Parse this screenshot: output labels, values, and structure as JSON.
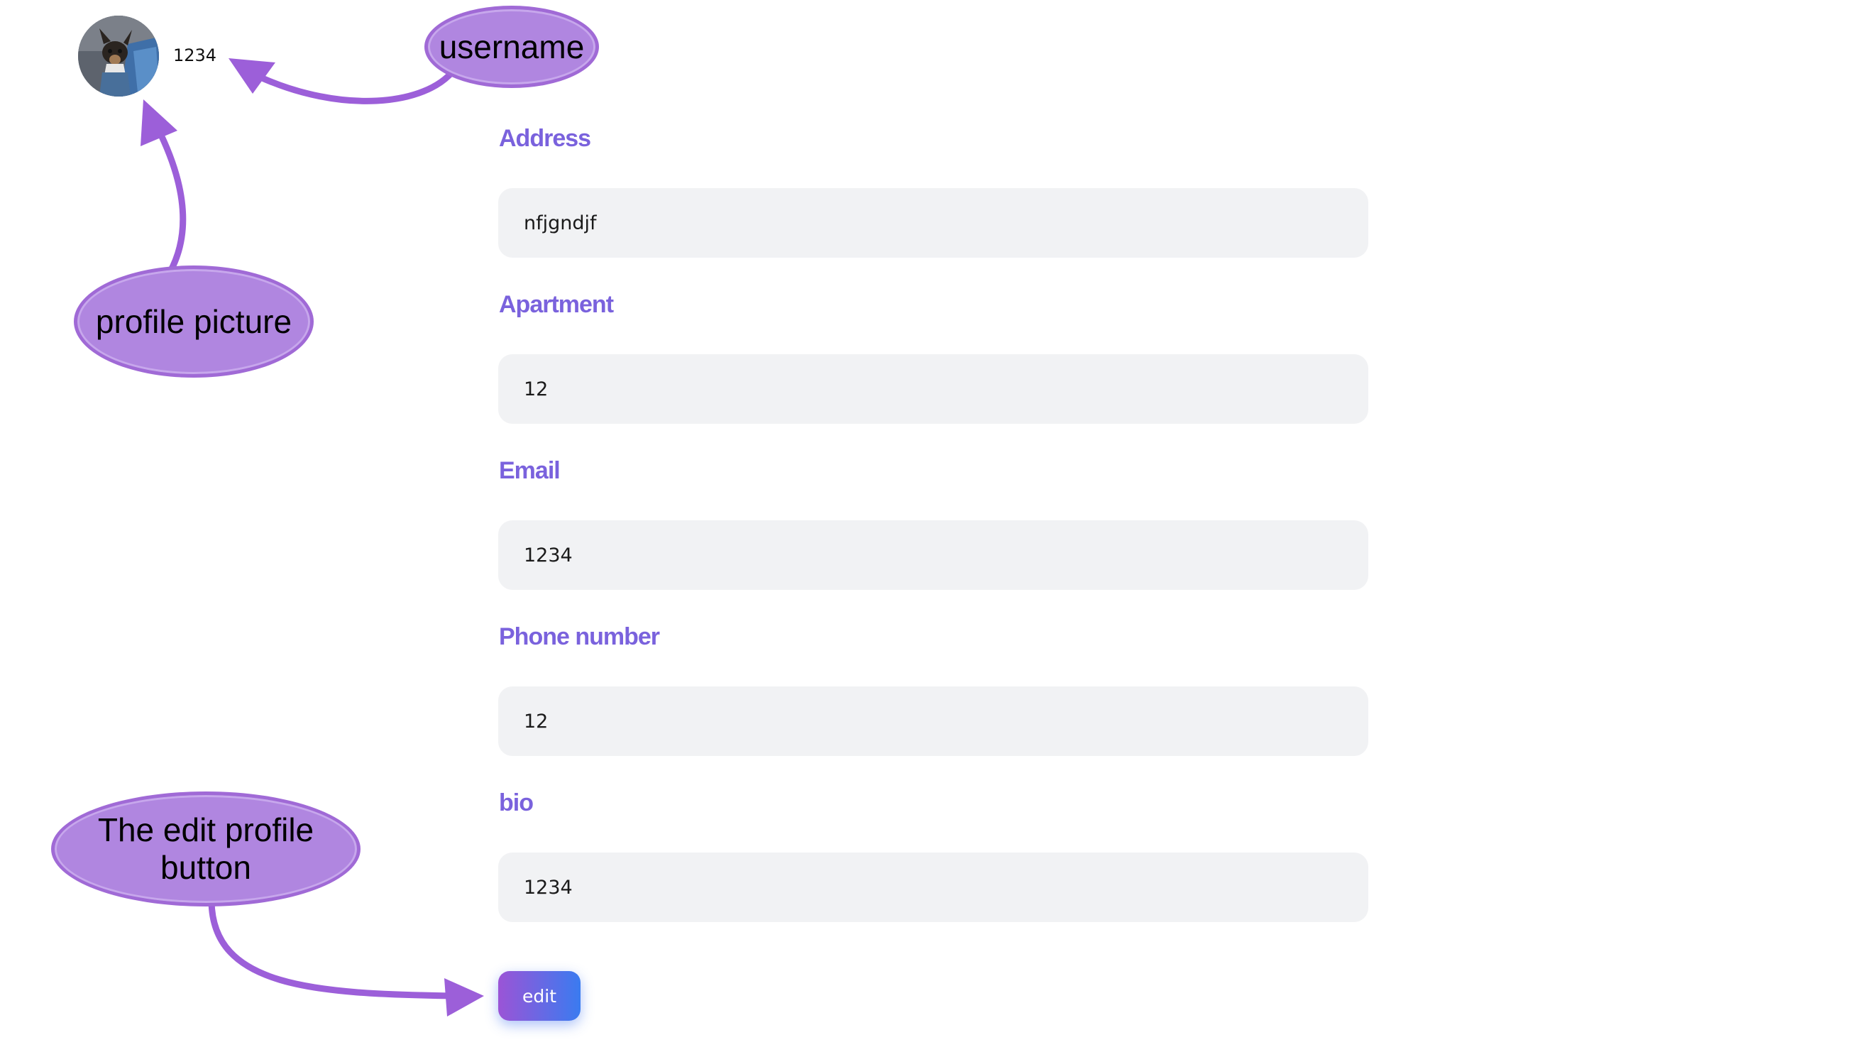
{
  "profile": {
    "username": "1234",
    "avatar_icon": "profile-photo"
  },
  "form": {
    "fields": [
      {
        "label": "Address",
        "value": "nfjgndjf"
      },
      {
        "label": "Apartment",
        "value": "12"
      },
      {
        "label": "Email",
        "value": "1234"
      },
      {
        "label": "Phone number",
        "value": "12"
      },
      {
        "label": "bio",
        "value": "1234"
      }
    ],
    "edit_label": "edit"
  },
  "annotations": {
    "username": "username",
    "profile_picture": "profile picture",
    "edit_button": "The edit profile button"
  },
  "colors": {
    "label": "#7a62dd",
    "field_bg": "#f1f2f4",
    "button_start": "#9b54d6",
    "button_end": "#3a7bf0",
    "annotation": "#b086e0",
    "arrow": "#9c5fd9"
  }
}
